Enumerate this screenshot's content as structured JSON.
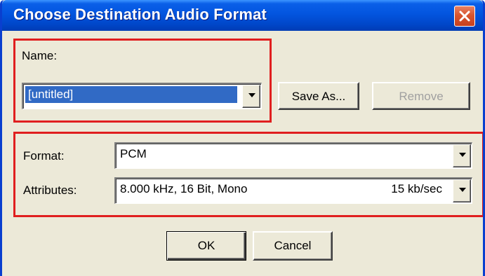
{
  "window": {
    "title": "Choose Destination Audio Format"
  },
  "name_section": {
    "label": "Name:",
    "value": "[untitled]",
    "save_as_label": "Save As...",
    "remove_label": "Remove"
  },
  "format_section": {
    "format_label": "Format:",
    "format_value": "PCM",
    "attributes_label": "Attributes:",
    "attributes_value": "8.000 kHz, 16 Bit, Mono",
    "attributes_rate": "15 kb/sec"
  },
  "buttons": {
    "ok_label": "OK",
    "cancel_label": "Cancel"
  },
  "colors": {
    "title_bar": "#0355df",
    "highlight": "#e01f1f",
    "selection": "#316ac5",
    "dialog_bg": "#ece9d8"
  }
}
